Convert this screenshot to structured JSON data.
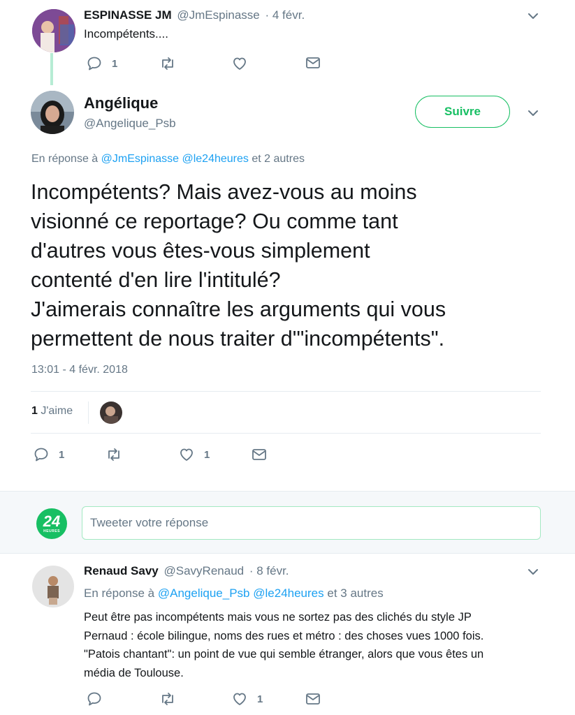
{
  "tweet1": {
    "name": "ESPINASSE JM",
    "handle": "@JmEspinasse",
    "date": "· 4 févr.",
    "text": "Incompétents....",
    "reply_count": "1"
  },
  "main": {
    "name": "Angélique",
    "handle": "@Angelique_Psb",
    "follow_label": "Suivre",
    "reply_prefix": "En réponse à",
    "reply_to_1": "@JmEspinasse",
    "reply_to_2": "@le24heures",
    "reply_suffix": "et 2 autres",
    "text_lines": [
      "Incompétents? Mais avez-vous au moins",
      "visionné ce reportage? Ou comme tant",
      "d'autres vous êtes-vous simplement",
      "contenté d'en lire l'intitulé?",
      "J'aimerais connaître les arguments qui vous",
      "permettent de nous traiter d'\"incompétents\"."
    ],
    "timestamp": "13:01 - 4 févr. 2018",
    "likes_count": "1",
    "likes_label": "J'aime",
    "reply_count": "1",
    "like_count": "1"
  },
  "composer": {
    "placeholder": "Tweeter votre réponse",
    "avatar_number": "24",
    "avatar_text": "HEURES"
  },
  "tweet3": {
    "name": "Renaud Savy",
    "handle": "@SavyRenaud",
    "date": "· 8 févr.",
    "reply_prefix": "En réponse à",
    "reply_to_1": "@Angelique_Psb",
    "reply_to_2": "@le24heures",
    "reply_suffix": "et 3 autres",
    "text_lines": [
      "Peut être pas incompétents mais vous ne sortez pas des clichés du style JP",
      "Pernaud : école bilingue, noms des rues et métro : des choses vues 1000 fois.",
      "\"Patois chantant\": un point de vue qui semble étranger, alors que vous êtes un",
      "média de Toulouse."
    ],
    "like_count": "1"
  },
  "colors": {
    "accent": "#17bf63",
    "link": "#1da1f2",
    "muted": "#657786",
    "text": "#14171a",
    "composer_bg": "#f5f8fa",
    "divider": "#e6ecf0"
  }
}
